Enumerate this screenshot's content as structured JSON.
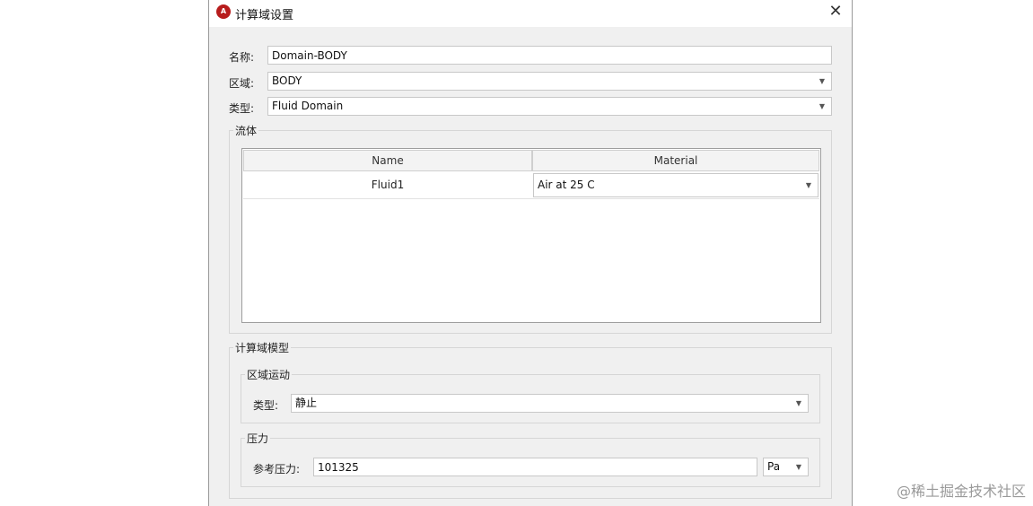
{
  "window": {
    "title": "计算域设置",
    "app_icon_text": "A"
  },
  "form": {
    "name_label": "名称:",
    "name_value": "Domain-BODY",
    "region_label": "区域:",
    "region_value": "BODY",
    "type_label": "类型:",
    "type_value": "Fluid Domain"
  },
  "fluid_group": {
    "title": "流体",
    "columns": [
      "Name",
      "Material"
    ],
    "rows": [
      {
        "name": "Fluid1",
        "material": "Air at 25 C"
      }
    ]
  },
  "domain_model": {
    "title": "计算域模型",
    "motion": {
      "title": "区域运动",
      "type_label": "类型:",
      "type_value": "静止"
    },
    "pressure": {
      "title": "压力",
      "ref_label": "参考压力:",
      "ref_value": "101325",
      "unit_value": "Pa"
    }
  },
  "watermark": "@稀土掘金技术社区"
}
